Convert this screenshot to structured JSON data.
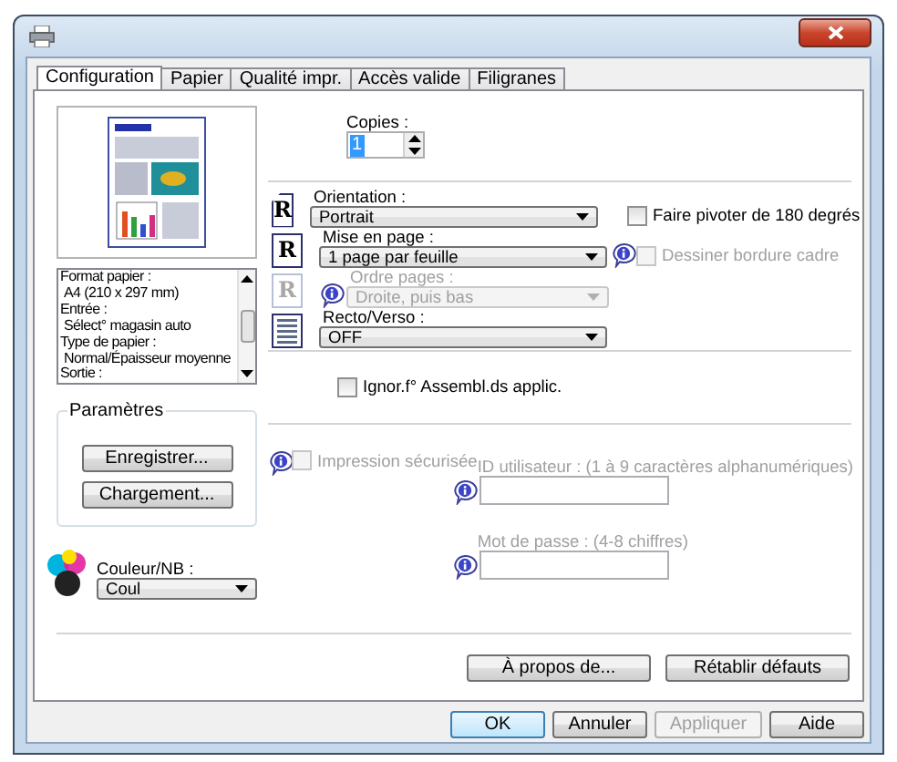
{
  "tabs": [
    {
      "label": "Configuration",
      "selected": true
    },
    {
      "label": "Papier",
      "selected": false
    },
    {
      "label": "Qualité impr.",
      "selected": false
    },
    {
      "label": "Accès valide",
      "selected": false
    },
    {
      "label": "Filigranes",
      "selected": false
    }
  ],
  "summary": [
    {
      "kind": "label",
      "text": "Format papier :"
    },
    {
      "kind": "value",
      "text": "A4 (210 x 297 mm)"
    },
    {
      "kind": "label",
      "text": "Entrée :"
    },
    {
      "kind": "value",
      "text": "Sélect° magasin auto"
    },
    {
      "kind": "label",
      "text": "Type de papier :"
    },
    {
      "kind": "value",
      "text": "Normal/Épaisseur moyenne"
    },
    {
      "kind": "label",
      "text": "Sortie :"
    }
  ],
  "parameters": {
    "title": "Paramètres",
    "buttons": [
      "Enregistrer...",
      "Chargement..."
    ]
  },
  "color_mode": {
    "label": "Couleur/NB :",
    "value": "Coul"
  },
  "copies": {
    "label": "Copies :",
    "value": "1"
  },
  "settings": [
    {
      "kind": "orientation",
      "glyph": "R",
      "label": "Orientation :",
      "value": "Portrait",
      "disabled": false,
      "option": {
        "label": "Faire pivoter de 180 degrés",
        "checked": false,
        "disabled": false
      }
    },
    {
      "kind": "layout",
      "glyph": "R",
      "label": "Mise en page :",
      "value": "1 page par feuille",
      "disabled": false,
      "option": {
        "label": "Dessiner bordure cadre",
        "checked": false,
        "disabled": true
      }
    },
    {
      "kind": "order",
      "glyph": "R",
      "label": "Ordre pages :",
      "value": "Droite, puis bas",
      "disabled": true
    },
    {
      "kind": "duplex",
      "label": "Recto/Verso :",
      "value": "OFF",
      "disabled": false
    }
  ],
  "collate": {
    "label": "Ignor.f° Assembl.ds applic.",
    "checked": false,
    "disabled": false
  },
  "secure": {
    "label": "Impression sécurisée",
    "checked": false,
    "disabled": true,
    "fields": [
      {
        "label": "ID utilisateur : (1 à 9 caractères alphanumériques)",
        "disabled": true
      },
      {
        "label": "Mot de passe : (4-8 chiffres)",
        "disabled": true
      }
    ]
  },
  "actions": [
    "À propos de...",
    "Rétablir défauts"
  ],
  "footer": [
    {
      "label": "OK",
      "default": true,
      "disabled": false
    },
    {
      "label": "Annuler",
      "default": false,
      "disabled": false
    },
    {
      "label": "Appliquer",
      "default": false,
      "disabled": true
    },
    {
      "label": "Aide",
      "default": false,
      "disabled": false
    }
  ]
}
